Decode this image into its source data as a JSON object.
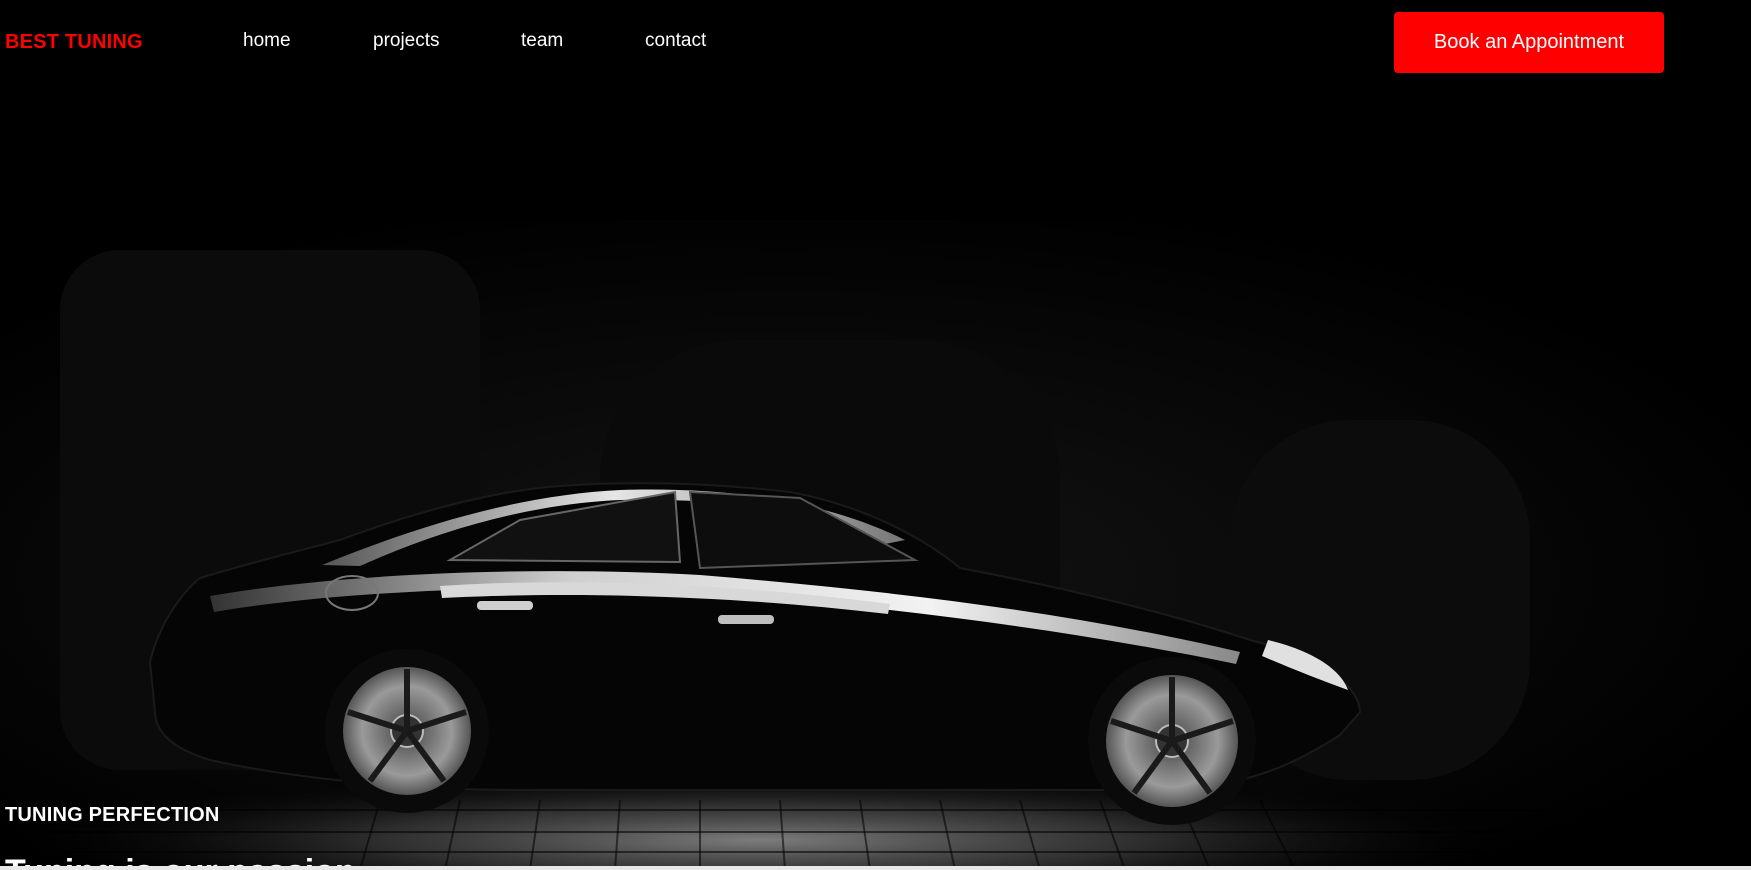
{
  "header": {
    "brand": "BEST TUNING",
    "nav": [
      {
        "label": "home"
      },
      {
        "label": "projects"
      },
      {
        "label": "team"
      },
      {
        "label": "contact"
      }
    ],
    "cta_label": "Book an Appointment"
  },
  "hero": {
    "image": "black-sports-car-side-profile",
    "tagline": "TUNING PERFECTION",
    "heading": "Tuning is our passion"
  },
  "colors": {
    "accent": "#ff0000",
    "background": "#000000",
    "text": "#ffffff"
  }
}
